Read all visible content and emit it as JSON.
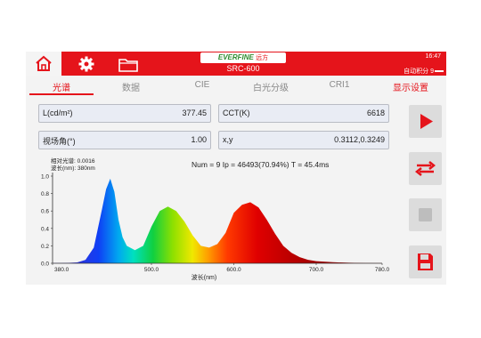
{
  "header": {
    "brand_name": "EVERFINE",
    "brand_cn": "远方",
    "model": "SRC-600",
    "time": "16:47",
    "integration_label": "自动积分 9"
  },
  "icons": {
    "home": "home-icon",
    "settings": "gear-icon",
    "folder": "folder-icon",
    "play": "play-icon",
    "loop": "loop-icon",
    "stop": "stop-icon",
    "save": "save-icon"
  },
  "tabs": [
    {
      "label": "光谱",
      "active": true
    },
    {
      "label": "数据"
    },
    {
      "label": "CIE"
    },
    {
      "label": "白光分级"
    },
    {
      "label": "CRI1"
    },
    {
      "label": "显示设置"
    }
  ],
  "fields": {
    "luminance": {
      "label": "L(cd/m²)",
      "value": "377.45"
    },
    "cct": {
      "label": "CCT(K)",
      "value": "6618"
    },
    "view_angle": {
      "label": "视场角(°)",
      "value": "1.00"
    },
    "xy": {
      "label": "x,y",
      "value": "0.3112,0.3249"
    }
  },
  "stats": "Num = 9  Ip = 46493(70.94%)  T = 45.4ms",
  "chart_data": {
    "type": "area",
    "cursor_readout": {
      "line1": "相对光谱: 0.0016",
      "line2": "波长(nm): 380nm"
    },
    "xlabel": "波长(nm)",
    "ylabel": "",
    "xlim": [
      380,
      780
    ],
    "ylim": [
      0,
      1.0
    ],
    "x_ticks": [
      "380.0",
      "500.0",
      "600.0",
      "700.0",
      "780.0"
    ],
    "y_ticks": [
      "1.0",
      "0.8",
      "0.6",
      "0.4",
      "0.2",
      "0.0"
    ],
    "x": [
      380,
      390,
      400,
      410,
      420,
      430,
      440,
      445,
      450,
      455,
      460,
      465,
      470,
      480,
      490,
      500,
      510,
      520,
      530,
      540,
      550,
      560,
      570,
      580,
      590,
      600,
      610,
      620,
      630,
      640,
      650,
      660,
      670,
      680,
      690,
      700,
      720,
      740,
      760,
      780
    ],
    "y": [
      0.002,
      0.003,
      0.005,
      0.01,
      0.04,
      0.18,
      0.62,
      0.85,
      0.97,
      0.82,
      0.5,
      0.3,
      0.2,
      0.15,
      0.2,
      0.42,
      0.6,
      0.65,
      0.6,
      0.48,
      0.32,
      0.2,
      0.18,
      0.22,
      0.35,
      0.58,
      0.67,
      0.7,
      0.64,
      0.5,
      0.34,
      0.2,
      0.12,
      0.07,
      0.04,
      0.025,
      0.012,
      0.006,
      0.003,
      0.001
    ]
  }
}
